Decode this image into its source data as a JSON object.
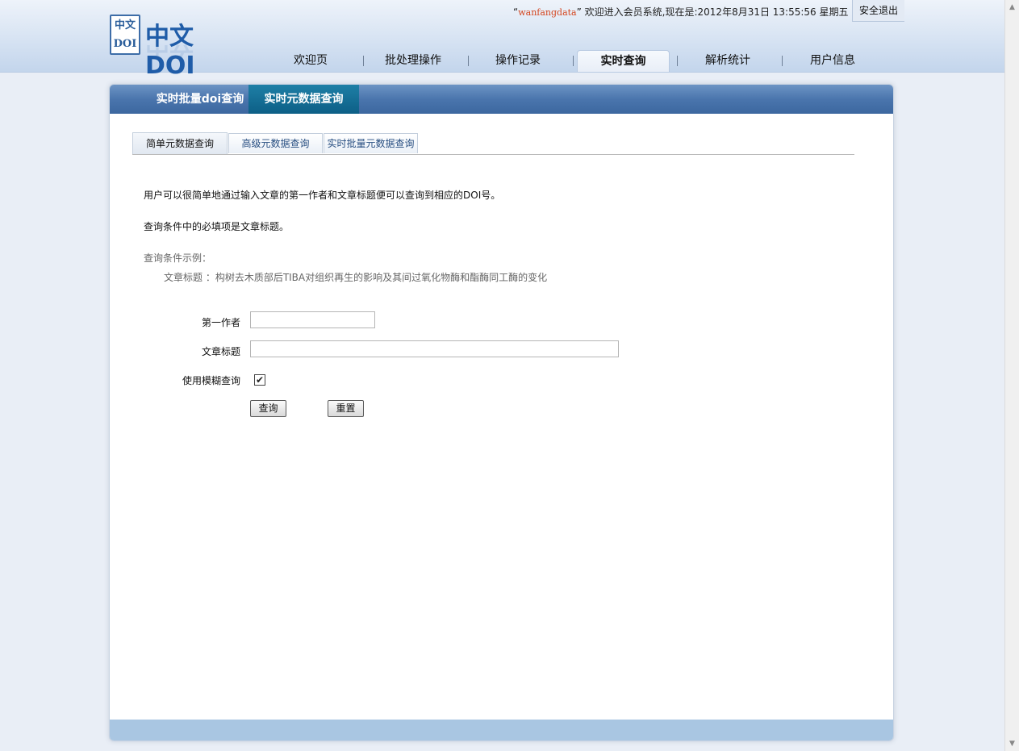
{
  "header": {
    "logo_seal_top": "中文",
    "logo_seal_bottom": "DOI",
    "logo_text": "中文DOI",
    "user_open_quote": "“",
    "username": "wanfangdata",
    "user_close_quote": "”",
    "welcome_text": "欢迎进入会员系统,现在是:2012年8月31日 13:55:56 星期五",
    "logout_label": "安全退出",
    "nav": [
      {
        "label": "欢迎页"
      },
      {
        "label": "批处理操作"
      },
      {
        "label": "操作记录"
      },
      {
        "label": "实时查询",
        "active": true
      },
      {
        "label": "解析统计"
      },
      {
        "label": "用户信息"
      }
    ]
  },
  "panel": {
    "tabs": [
      {
        "label": "实时批量doi查询"
      },
      {
        "label": "实时元数据查询",
        "active": true
      }
    ],
    "subtabs": [
      {
        "label": "简单元数据查询",
        "active": true
      },
      {
        "label": "高级元数据查询"
      },
      {
        "label": "实时批量元数据查询"
      }
    ]
  },
  "content": {
    "intro": "用户可以很简单地通过输入文章的第一作者和文章标题便可以查询到相应的DOI号。",
    "required_note": "查询条件中的必填项是文章标题。",
    "example_heading": "查询条件示例：",
    "example_text": "文章标题 ：构树去木质部后TIBA对组织再生的影响及其间过氧化物酶和酯酶同工酶的变化"
  },
  "form": {
    "author_label": "第一作者",
    "author_value": "",
    "title_label": "文章标题",
    "title_value": "",
    "fuzzy_label": "使用模糊查询",
    "fuzzy_checked": true,
    "fuzzy_mark": "✔",
    "search_label": "查询",
    "reset_label": "重置"
  },
  "colors": {
    "accent": "#3c679f",
    "active_tab": "#0d5f86",
    "username": "#d4461f",
    "footer_bar": "#a9c6e2"
  }
}
